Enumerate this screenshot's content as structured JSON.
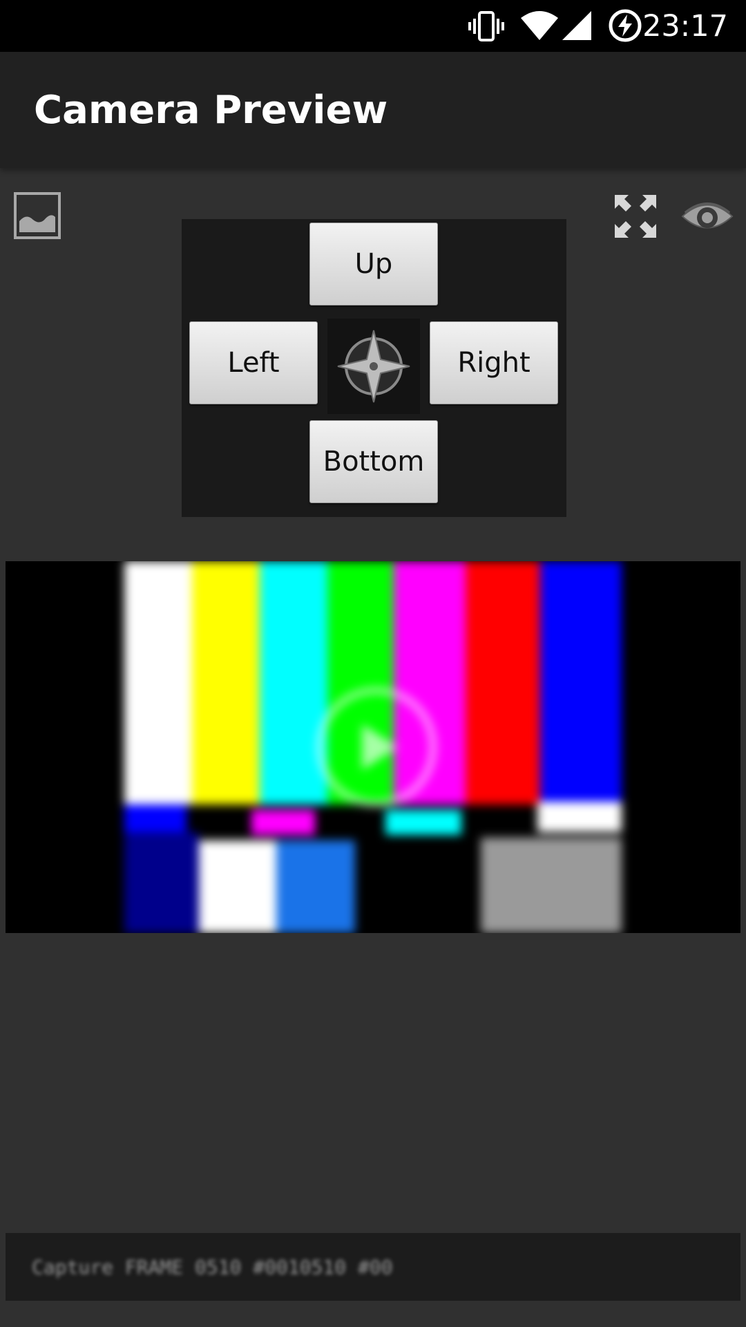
{
  "status_bar": {
    "time": "23:17",
    "icons": [
      "vibrate-icon",
      "wifi-icon",
      "signal-icon",
      "battery-charging-icon"
    ]
  },
  "app_bar": {
    "title": "Camera Preview"
  },
  "toolbar": {
    "left_icon": "image-icon",
    "right_icons": [
      "fullscreen-icon",
      "eye-icon"
    ]
  },
  "dpad": {
    "up_label": "Up",
    "left_label": "Left",
    "right_label": "Right",
    "bottom_label": "Bottom",
    "center_icon": "compass-icon"
  },
  "preview": {
    "content": "color bars test pattern",
    "overlay_icon": "play-icon",
    "colors": {
      "white": "#ffffff",
      "yellow": "#ffff00",
      "cyan": "#00ffff",
      "green": "#00ff00",
      "magenta": "#ff00ff",
      "red": "#ff0000",
      "blue": "#0000ff",
      "navy": "#00008b",
      "azure": "#1a73e8",
      "gray": "#9a9a9a"
    }
  },
  "footer": {
    "text": "Capture FRAME 0510 #0010510 #00"
  }
}
